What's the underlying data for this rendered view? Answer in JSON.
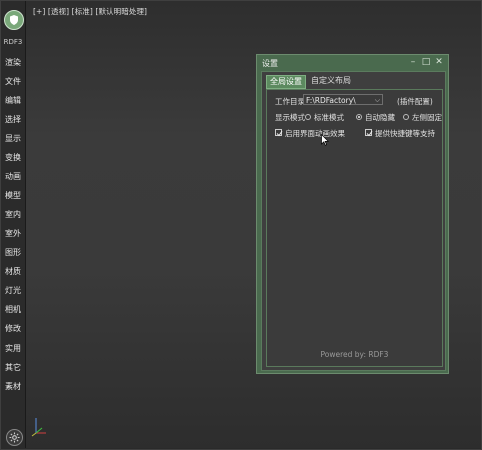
{
  "sidebar": {
    "logo_text": "RDF3",
    "items": [
      "渲染",
      "文件",
      "编辑",
      "选择",
      "显示",
      "变换",
      "动画",
      "模型",
      "室内",
      "室外",
      "图形",
      "材质",
      "灯光",
      "相机",
      "修改",
      "实用",
      "其它",
      "素材"
    ]
  },
  "viewport": {
    "labels": [
      "[+]",
      "[透视]",
      "[标准]",
      "[默认明暗处理]"
    ]
  },
  "dialog": {
    "title": "设置",
    "tabs": [
      "全局设置",
      "自定义布局"
    ],
    "work_dir_label": "工作目录",
    "work_dir_value": "F:\\RDFactory\\",
    "plugin_config": "(插件配置)",
    "display_mode_label": "显示模式",
    "modes": [
      "标准模式",
      "自动隐藏",
      "左侧固定"
    ],
    "selected_mode": "自动隐藏",
    "checkboxes": [
      {
        "label": "启用界面动画效果",
        "checked": true
      },
      {
        "label": "提供快捷键等支持",
        "checked": true
      }
    ],
    "footer": "Powered by: RDF3"
  },
  "colors": {
    "accent": "#5c8a5f",
    "dialog_frame": "#4a6a4e",
    "logo": "#7aa87a"
  }
}
